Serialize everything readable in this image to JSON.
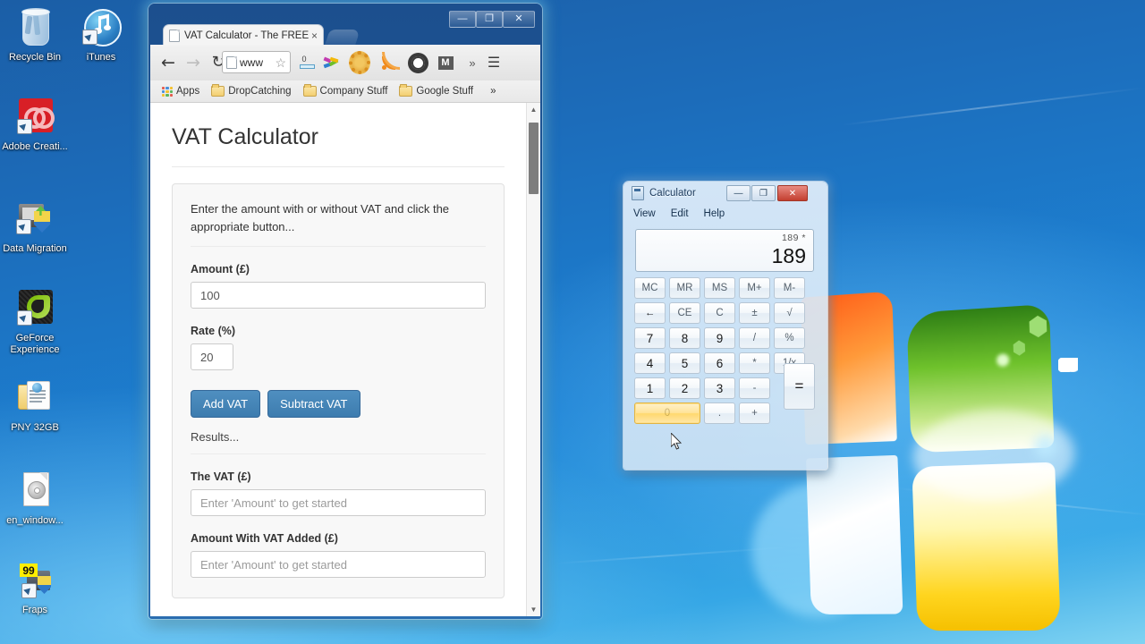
{
  "desktop": {
    "icons": [
      {
        "name": "Recycle Bin",
        "id": "recycle-bin"
      },
      {
        "name": "iTunes",
        "id": "itunes"
      },
      {
        "name": "Adobe Creati...",
        "id": "adobe-creative-cloud"
      },
      {
        "name": "Data Migration",
        "id": "data-migration"
      },
      {
        "name": "GeForce Experience",
        "id": "geforce-experience"
      },
      {
        "name": "PNY 32GB",
        "id": "pny-32gb"
      },
      {
        "name": "en_window...",
        "id": "en-windows-iso"
      },
      {
        "name": "Fraps",
        "id": "fraps"
      }
    ]
  },
  "browser": {
    "tab_title": "VAT Calculator - The FREE",
    "tab_close": "×",
    "new_tab": "",
    "window_controls": {
      "minimize": "—",
      "maximize": "❐",
      "close": "✕"
    },
    "nav": {
      "back": "←",
      "forward": "→",
      "reload": "↻",
      "menu": "☰",
      "overflow": "»"
    },
    "omnibox": {
      "url": "www",
      "star": "☆"
    },
    "extensions": [
      {
        "id": "download-counter-icon",
        "glyph": "0"
      },
      {
        "id": "colorful-brush-icon",
        "glyph": "✒"
      },
      {
        "id": "seo-gear-icon",
        "glyph": "⚙"
      },
      {
        "id": "rss-feed-icon",
        "glyph": "◔"
      },
      {
        "id": "settings-gear-icon",
        "glyph": "⚙"
      },
      {
        "id": "gmail-icon",
        "glyph": "M"
      }
    ],
    "bookmarks": [
      {
        "label": "Apps",
        "type": "apps"
      },
      {
        "label": "DropCatching",
        "type": "folder"
      },
      {
        "label": "Company Stuff",
        "type": "folder"
      },
      {
        "label": "Google Stuff",
        "type": "folder"
      },
      {
        "label": "»",
        "type": "overflow"
      }
    ],
    "scrollbar": {
      "up": "▲",
      "down": "▼"
    }
  },
  "page": {
    "title": "VAT Calculator",
    "instruction": "Enter the amount with or without VAT and click the appropriate button...",
    "fields": [
      {
        "label": "Amount (£)",
        "value": "100",
        "placeholder": "",
        "size": "full"
      },
      {
        "label": "Rate (%)",
        "value": "20",
        "placeholder": "",
        "size": "small"
      }
    ],
    "buttons": {
      "add": "Add VAT",
      "subtract": "Subtract VAT"
    },
    "results_label": "Results...",
    "results": [
      {
        "label": "The VAT (£)",
        "value": "",
        "placeholder": "Enter 'Amount' to get started"
      },
      {
        "label": "Amount With VAT Added (£)",
        "value": "",
        "placeholder": "Enter 'Amount' to get started"
      }
    ],
    "accent_color": "#4080b4"
  },
  "calculator": {
    "title": "Calculator",
    "window_controls": {
      "minimize": "—",
      "maximize": "❐",
      "close": "✕"
    },
    "menu": [
      "View",
      "Edit",
      "Help"
    ],
    "display": {
      "history": "189  *",
      "value": "189"
    },
    "keys": [
      [
        {
          "l": "MC",
          "k": "mem-clear"
        },
        {
          "l": "MR",
          "k": "mem-recall"
        },
        {
          "l": "MS",
          "k": "mem-store"
        },
        {
          "l": "M+",
          "k": "mem-add"
        },
        {
          "l": "M-",
          "k": "mem-subtract"
        }
      ],
      [
        {
          "l": "←",
          "k": "backspace"
        },
        {
          "l": "CE",
          "k": "clear-entry"
        },
        {
          "l": "C",
          "k": "clear"
        },
        {
          "l": "±",
          "k": "sign"
        },
        {
          "l": "√",
          "k": "sqrt"
        }
      ],
      [
        {
          "l": "7",
          "k": "seven"
        },
        {
          "l": "8",
          "k": "eight"
        },
        {
          "l": "9",
          "k": "nine"
        },
        {
          "l": "/",
          "k": "divide"
        },
        {
          "l": "%",
          "k": "percent"
        }
      ],
      [
        {
          "l": "4",
          "k": "four"
        },
        {
          "l": "5",
          "k": "five"
        },
        {
          "l": "6",
          "k": "six"
        },
        {
          "l": "*",
          "k": "multiply"
        },
        {
          "l": "1/x",
          "k": "reciprocal"
        }
      ],
      [
        {
          "l": "1",
          "k": "one"
        },
        {
          "l": "2",
          "k": "two"
        },
        {
          "l": "3",
          "k": "three"
        },
        {
          "l": "-",
          "k": "minus"
        }
      ],
      [
        {
          "l": "0",
          "k": "zero"
        },
        {
          "l": ".",
          "k": "decimal"
        },
        {
          "l": "+",
          "k": "plus"
        }
      ]
    ],
    "equals": "=",
    "hovered_key": "0",
    "hover_color": "#ffd86e"
  }
}
